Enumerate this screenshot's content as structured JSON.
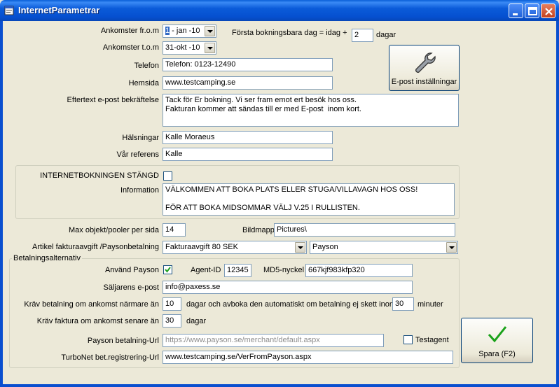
{
  "window": {
    "title": "InternetParametrar"
  },
  "form": {
    "ankomster_from_label": "Ankomster fr.o.m",
    "ankomster_from_value_sel": "1",
    "ankomster_from_value_rest": " - jan -10",
    "ankomster_tom_label": "Ankomster t.o.m",
    "ankomster_tom_value": "31-okt -10",
    "forsta_label": "Första bokningsbara dag = idag +",
    "forsta_value": "2",
    "forsta_unit": "dagar",
    "telefon_label": "Telefon",
    "telefon_value": "Telefon: 0123-12490",
    "hemsida_label": "Hemsida",
    "hemsida_value": "www.testcamping.se",
    "eftertext_label": "Eftertext e-post bekräftelse",
    "eftertext_value": "Tack för Er bokning. Vi ser fram emot ert besök hos oss.\nFakturan kommer att sändas till er med E-post  inom kort.",
    "halsningar_label": "Hälsningar",
    "halsningar_value": "Kalle Moraeus",
    "var_referens_label": "Vår referens",
    "var_referens_value": "Kalle",
    "internet_stangd_label": "INTERNETBOKNINGEN STÄNGD",
    "information_label": "Information",
    "information_value": "VÄLKOMMEN ATT BOKA PLATS ELLER STUGA/VILLAVAGN HOS OSS!\n\nFÖR ATT BOKA MIDSOMMAR VÄLJ V.25 I RULLISTEN.",
    "max_objekt_label": "Max objekt/pooler per sida",
    "max_objekt_value": "14",
    "bildmapp_label": "Bildmapp",
    "bildmapp_value": "Pictures\\",
    "artikel_label": "Artikel fakturaavgift /Paysonbetalning",
    "artikel_value": "Fakturaavgift 80 SEK",
    "payson_select_value": "Payson"
  },
  "epost_button": {
    "label": "E-post inställningar",
    "icon": "wrench-icon"
  },
  "betalning": {
    "group_title": "Betalningsalternativ",
    "anvand_payson_label": "Använd Payson",
    "anvand_payson_checked": true,
    "agent_id_label": "Agent-ID",
    "agent_id_value": "12345",
    "md5_label": "MD5-nyckel",
    "md5_value": "667kjf983kfp320",
    "saljarens_label": "Säljarens e-post",
    "saljarens_value": "info@paxess.se",
    "krav_betalning_label": "Kräv betalning om ankomst närmare än",
    "krav_betalning_value": "10",
    "krav_betalning_mid": "dagar och avboka den automatiskt om betalning ej skett inom",
    "krav_minuter_value": "30",
    "krav_minuter_unit": "minuter",
    "krav_faktura_label": "Kräv faktura om ankomst senare än",
    "krav_faktura_value": "30",
    "krav_faktura_unit": "dagar",
    "payson_url_label": "Payson betalning-Url",
    "payson_url_value": "https://www.payson.se/merchant/default.aspx",
    "testagent_label": "Testagent",
    "testagent_checked": false,
    "turbonet_label": "TurboNet bet.registrering-Url",
    "turbonet_value": "www.testcamping.se/VerFromPayson.aspx"
  },
  "save_button": {
    "label": "Spara (F2)",
    "icon": "checkmark-icon"
  },
  "colors": {
    "titlebar": "#0a5fd8",
    "background": "#ece9d8",
    "input_border": "#7f9db9",
    "check_green": "#1aa21a"
  }
}
